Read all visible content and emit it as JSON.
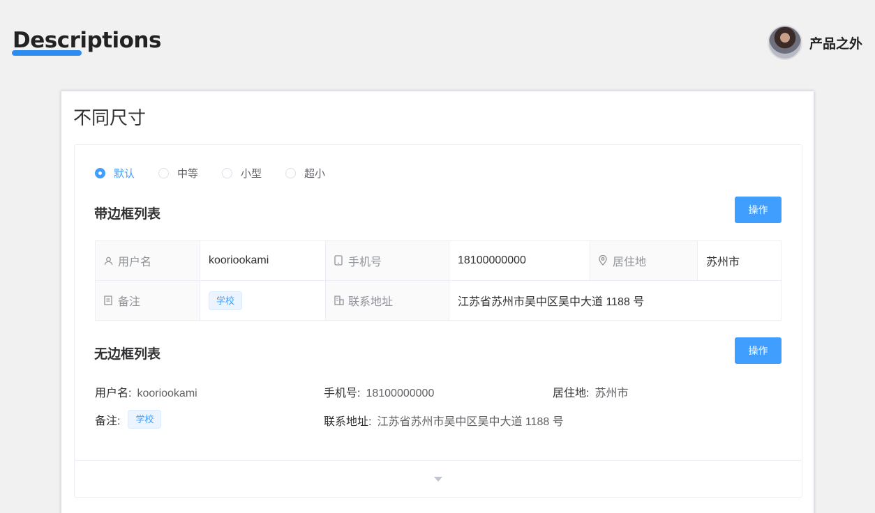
{
  "header": {
    "title": "Descriptions",
    "brand": "产品之外",
    "accent": "#2d8cf0"
  },
  "card": {
    "title": "不同尺寸",
    "radios": [
      {
        "label": "默认",
        "checked": true
      },
      {
        "label": "中等",
        "checked": false
      },
      {
        "label": "小型",
        "checked": false
      },
      {
        "label": "超小",
        "checked": false
      }
    ],
    "bordered": {
      "title": "带边框列表",
      "action": "操作",
      "username_label": "用户名",
      "username_value": "kooriookami",
      "phone_label": "手机号",
      "phone_value": "18100000000",
      "city_label": "居住地",
      "city_value": "苏州市",
      "remark_label": "备注",
      "remark_tag": "学校",
      "address_label": "联系地址",
      "address_value": "江苏省苏州市吴中区吴中大道 1188 号"
    },
    "plain": {
      "title": "无边框列表",
      "action": "操作",
      "username_label": "用户名:",
      "username_value": "kooriookami",
      "phone_label": "手机号:",
      "phone_value": "18100000000",
      "city_label": "居住地:",
      "city_value": "苏州市",
      "remark_label": "备注:",
      "remark_tag": "学校",
      "address_label": "联系地址:",
      "address_value": "江苏省苏州市吴中区吴中大道 1188 号"
    }
  },
  "colors": {
    "primary": "#409eff",
    "tag_bg": "#ecf5ff"
  },
  "icons": [
    "user-icon",
    "phone-icon",
    "location-icon",
    "note-icon",
    "office-icon",
    "caret-down-icon"
  ]
}
